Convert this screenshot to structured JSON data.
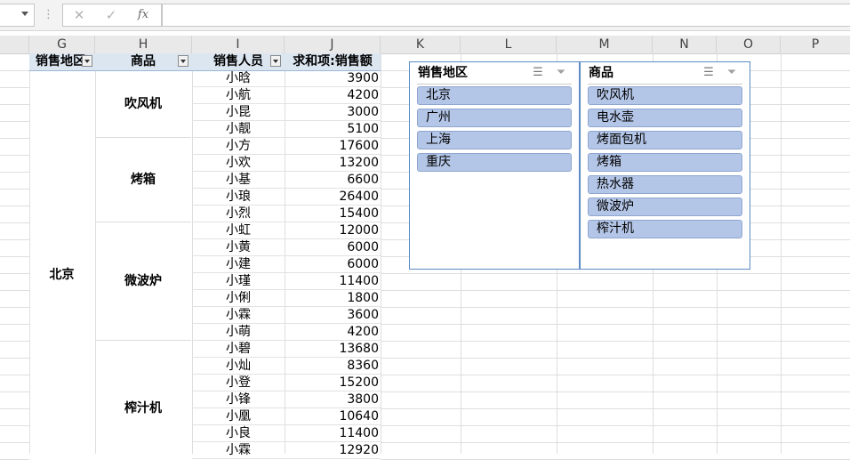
{
  "formula_bar": {
    "cancel_icon": "✕",
    "enter_icon": "✓",
    "fx_icon": "fx",
    "separator": "⋮",
    "formula": ""
  },
  "columns": [
    "G",
    "H",
    "I",
    "J",
    "K",
    "L",
    "M",
    "N",
    "O",
    "P"
  ],
  "pivot": {
    "headers": {
      "region": "销售地区",
      "product": "商品",
      "person": "销售人员",
      "sum": "求和项:销售额"
    },
    "region": "北京",
    "products": [
      "吹风机",
      "烤箱",
      "微波炉",
      "榨汁机"
    ],
    "rows": [
      {
        "name": "小晗",
        "value": "3900"
      },
      {
        "name": "小航",
        "value": "4200"
      },
      {
        "name": "小昆",
        "value": "3000"
      },
      {
        "name": "小靓",
        "value": "5100"
      },
      {
        "name": "小方",
        "value": "17600"
      },
      {
        "name": "小欢",
        "value": "13200"
      },
      {
        "name": "小基",
        "value": "6600"
      },
      {
        "name": "小琅",
        "value": "26400"
      },
      {
        "name": "小烈",
        "value": "15400"
      },
      {
        "name": "小虹",
        "value": "12000"
      },
      {
        "name": "小黄",
        "value": "6000"
      },
      {
        "name": "小建",
        "value": "6000"
      },
      {
        "name": "小瑾",
        "value": "11400"
      },
      {
        "name": "小俐",
        "value": "1800"
      },
      {
        "name": "小霖",
        "value": "3600"
      },
      {
        "name": "小萌",
        "value": "4200"
      },
      {
        "name": "小碧",
        "value": "13680"
      },
      {
        "name": "小灿",
        "value": "8360"
      },
      {
        "name": "小登",
        "value": "15200"
      },
      {
        "name": "小锋",
        "value": "3800"
      },
      {
        "name": "小凰",
        "value": "10640"
      },
      {
        "name": "小良",
        "value": "11400"
      },
      {
        "name": "小霖",
        "value": "12920"
      }
    ]
  },
  "slicers": [
    {
      "title": "销售地区",
      "multiselect_icon": "multi-select-icon",
      "clear_filter_icon": "clear-filter-icon",
      "items": [
        "北京",
        "广州",
        "上海",
        "重庆"
      ]
    },
    {
      "title": "商品",
      "multiselect_icon": "multi-select-icon",
      "clear_filter_icon": "clear-filter-icon",
      "items": [
        "吹风机",
        "电水壶",
        "烤面包机",
        "烤箱",
        "热水器",
        "微波炉",
        "榨汁机"
      ]
    }
  ],
  "colors": {
    "slicer_item": "#b4c6e7",
    "slicer_border": "#5b8bc4",
    "pivot_header": "#dce6f1"
  }
}
